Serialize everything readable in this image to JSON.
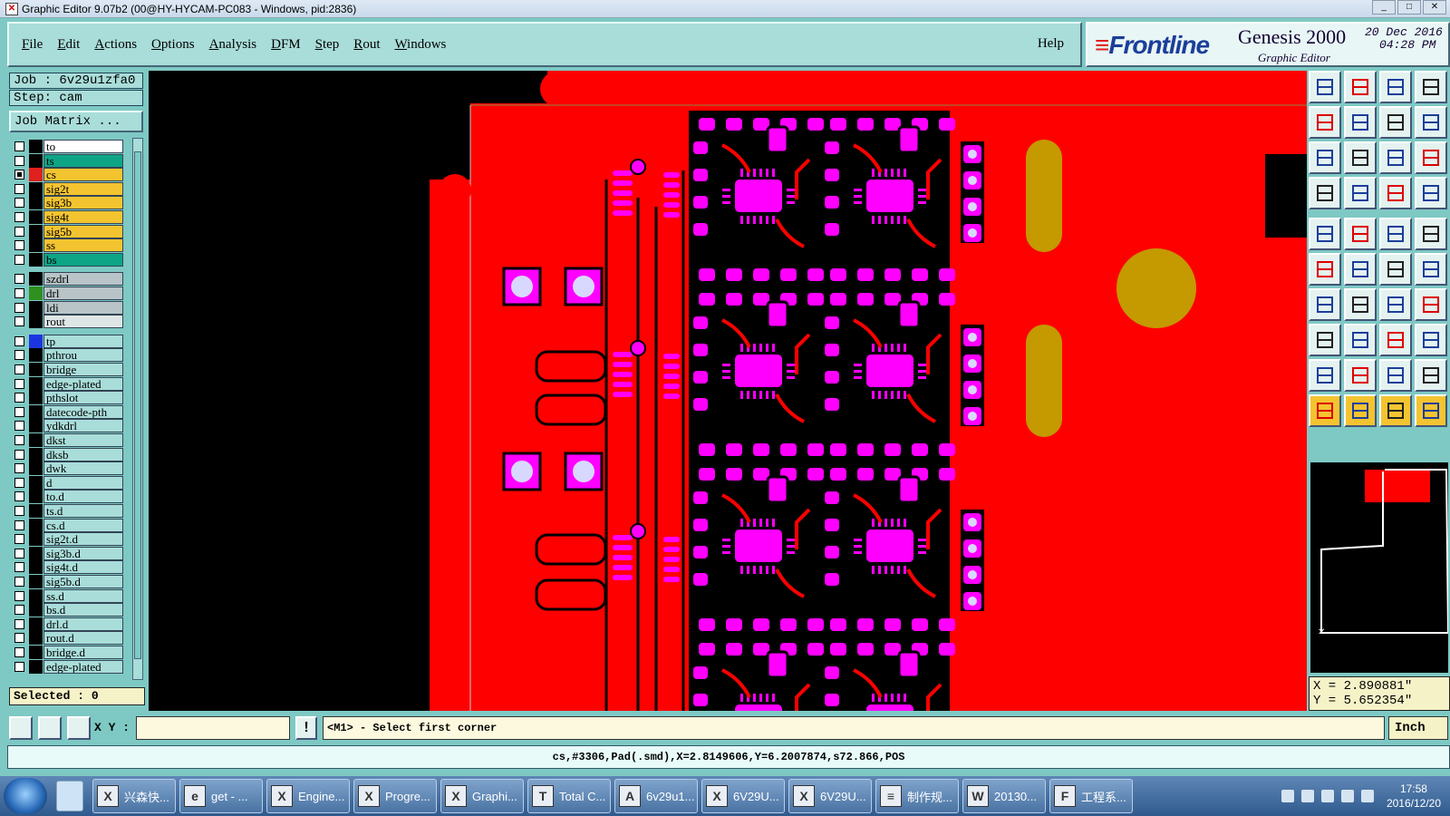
{
  "window": {
    "title": "Graphic Editor 9.07b2 (00@HY-HYCAM-PC083 - Windows, pid:2836)",
    "controls": [
      "_",
      "□",
      "✕"
    ]
  },
  "menu": {
    "items": [
      "File",
      "Edit",
      "Actions",
      "Options",
      "Analysis",
      "DFM",
      "Step",
      "Rout",
      "Windows"
    ],
    "help": "Help"
  },
  "brand": {
    "logo": "Frontline",
    "product": "Genesis 2000",
    "subtitle": "Graphic Editor",
    "date": "20 Dec 2016",
    "time": "04:28 PM"
  },
  "job": {
    "job_line": "Job : 6v29u1zfa0",
    "step_line": "Step: cam",
    "matrix_button": "Job Matrix ..."
  },
  "layers": [
    {
      "name": "to",
      "color": "#ffffff",
      "swatch": "#000000",
      "checked": false
    },
    {
      "name": "ts",
      "color": "#0ea586",
      "swatch": "#000000",
      "checked": false
    },
    {
      "name": "cs",
      "color": "#f4c430",
      "swatch": "#e0201c",
      "checked": true
    },
    {
      "name": "sig2t",
      "color": "#f4c430",
      "swatch": "#000000",
      "checked": false
    },
    {
      "name": "sig3b",
      "color": "#f4c430",
      "swatch": "#000000",
      "checked": false
    },
    {
      "name": "sig4t",
      "color": "#f4c430",
      "swatch": "#000000",
      "checked": false
    },
    {
      "name": "sig5b",
      "color": "#f4c430",
      "swatch": "#000000",
      "checked": false
    },
    {
      "name": "ss",
      "color": "#f4c430",
      "swatch": "#000000",
      "checked": false
    },
    {
      "name": "bs",
      "color": "#0ea586",
      "swatch": "#000000",
      "checked": false
    },
    {
      "name": "szdrl",
      "color": "#b8c4c8",
      "swatch": "#000000",
      "checked": false
    },
    {
      "name": "drl",
      "color": "#b8c4c8",
      "swatch": "#2f8f1f",
      "checked": false
    },
    {
      "name": "ldi",
      "color": "#b8c4c8",
      "swatch": "#000000",
      "checked": false
    },
    {
      "name": "rout",
      "color": "#dfe6e6",
      "swatch": "#000000",
      "checked": false
    },
    {
      "name": "tp",
      "color": "#a9ddd9",
      "swatch": "#1b36e0",
      "checked": false
    },
    {
      "name": "pthrou",
      "color": "#a9ddd9",
      "swatch": "#000000",
      "checked": false
    },
    {
      "name": "bridge",
      "color": "#a9ddd9",
      "swatch": "#000000",
      "checked": false
    },
    {
      "name": "edge-plated",
      "color": "#a9ddd9",
      "swatch": "#000000",
      "checked": false
    },
    {
      "name": "pthslot",
      "color": "#a9ddd9",
      "swatch": "#000000",
      "checked": false
    },
    {
      "name": "datecode-pth",
      "color": "#a9ddd9",
      "swatch": "#000000",
      "checked": false
    },
    {
      "name": "ydkdrl",
      "color": "#a9ddd9",
      "swatch": "#000000",
      "checked": false
    },
    {
      "name": "dkst",
      "color": "#a9ddd9",
      "swatch": "#000000",
      "checked": false
    },
    {
      "name": "dksb",
      "color": "#a9ddd9",
      "swatch": "#000000",
      "checked": false
    },
    {
      "name": "dwk",
      "color": "#a9ddd9",
      "swatch": "#000000",
      "checked": false
    },
    {
      "name": "d",
      "color": "#a9ddd9",
      "swatch": "#000000",
      "checked": false
    },
    {
      "name": "to.d",
      "color": "#a9ddd9",
      "swatch": "#000000",
      "checked": false
    },
    {
      "name": "ts.d",
      "color": "#a9ddd9",
      "swatch": "#000000",
      "checked": false
    },
    {
      "name": "cs.d",
      "color": "#a9ddd9",
      "swatch": "#000000",
      "checked": false
    },
    {
      "name": "sig2t.d",
      "color": "#a9ddd9",
      "swatch": "#000000",
      "checked": false
    },
    {
      "name": "sig3b.d",
      "color": "#a9ddd9",
      "swatch": "#000000",
      "checked": false
    },
    {
      "name": "sig4t.d",
      "color": "#a9ddd9",
      "swatch": "#000000",
      "checked": false
    },
    {
      "name": "sig5b.d",
      "color": "#a9ddd9",
      "swatch": "#000000",
      "checked": false
    },
    {
      "name": "ss.d",
      "color": "#a9ddd9",
      "swatch": "#000000",
      "checked": false
    },
    {
      "name": "bs.d",
      "color": "#a9ddd9",
      "swatch": "#000000",
      "checked": false
    },
    {
      "name": "drl.d",
      "color": "#a9ddd9",
      "swatch": "#000000",
      "checked": false
    },
    {
      "name": "rout.d",
      "color": "#a9ddd9",
      "swatch": "#000000",
      "checked": false
    },
    {
      "name": "bridge.d",
      "color": "#a9ddd9",
      "swatch": "#000000",
      "checked": false
    },
    {
      "name": "edge-plated",
      "color": "#a9ddd9",
      "swatch": "#000000",
      "checked": false
    }
  ],
  "selected": "Selected : 0",
  "coords": {
    "x": "X = 2.890881\"",
    "y": "Y = 5.652354\""
  },
  "command": {
    "xy_label": "X Y :",
    "xy_value": "",
    "exclaim": "!",
    "prompt": "<M1> - Select first corner",
    "units": "Inch"
  },
  "status": "cs,#3306,Pad(.smd),X=2.8149606,Y=6.2007874,s72.866,POS",
  "taskbar": {
    "items": [
      {
        "label": "兴森快...",
        "icon": "X"
      },
      {
        "label": "get - ...",
        "icon": "e"
      },
      {
        "label": "Engine...",
        "icon": "X"
      },
      {
        "label": "Progre...",
        "icon": "X"
      },
      {
        "label": "Graphi...",
        "icon": "X"
      },
      {
        "label": "Total C...",
        "icon": "T"
      },
      {
        "label": "6v29u1...",
        "icon": "A"
      },
      {
        "label": "6V29U...",
        "icon": "X"
      },
      {
        "label": "6V29U...",
        "icon": "X"
      },
      {
        "label": "制作规...",
        "icon": "≡"
      },
      {
        "label": "20130...",
        "icon": "W"
      },
      {
        "label": "工程系...",
        "icon": "F"
      }
    ],
    "clock_time": "17:58",
    "clock_date": "2016/12/20"
  },
  "colors": {
    "copper": "#ff0000",
    "pad": "#ff00ff",
    "gold": "#c49a00",
    "panel": "#7ec9c4"
  }
}
